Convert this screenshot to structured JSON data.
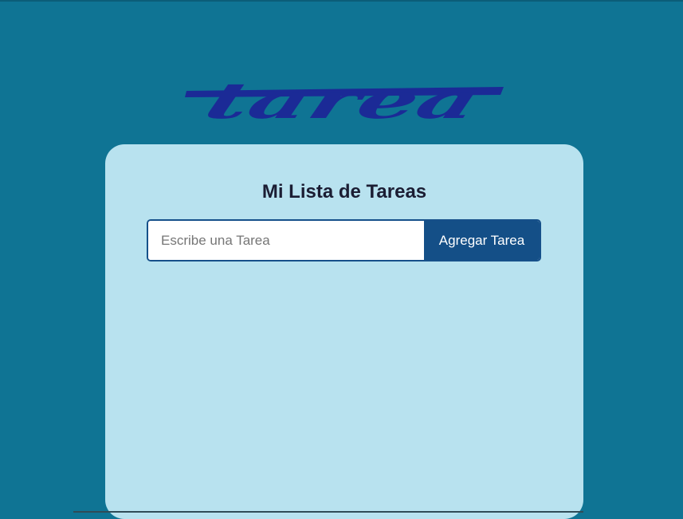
{
  "logo": {
    "text": "tarea",
    "color": "#1b2a96"
  },
  "card": {
    "title": "Mi Lista de Tareas"
  },
  "task_form": {
    "input_value": "",
    "input_placeholder": "Escribe una Tarea",
    "add_button_label": "Agregar Tarea"
  },
  "tasks": [],
  "colors": {
    "page_background": "#0f7494",
    "card_background": "#b8e2ef",
    "accent": "#144f87",
    "title_text": "#1b1d33"
  }
}
